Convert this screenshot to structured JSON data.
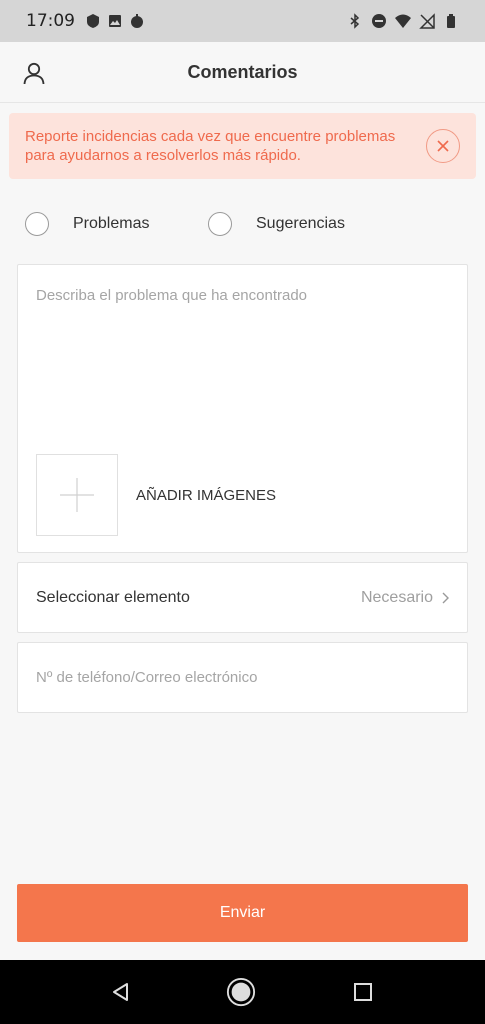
{
  "status_bar": {
    "time": "17:09",
    "left_icons": [
      "shield-icon",
      "image-icon",
      "bomb-icon"
    ],
    "right_icons": [
      "bluetooth-icon",
      "do-not-disturb-icon",
      "wifi-icon",
      "no-signal-icon",
      "battery-icon"
    ]
  },
  "header": {
    "title": "Comentarios",
    "user_icon": "user-icon"
  },
  "notice": {
    "text": "Reporte incidencias cada vez que encuentre problemas para ayudarnos a resolverlos más rápido.",
    "close_icon": "close-icon"
  },
  "feedback_type": {
    "options": [
      {
        "label": "Problemas",
        "selected": false
      },
      {
        "label": "Sugerencias",
        "selected": false
      }
    ]
  },
  "description": {
    "placeholder": "Describa el problema que ha encontrado",
    "add_images_label": "AÑADIR IMÁGENES",
    "add_icon": "plus-icon"
  },
  "select_item": {
    "label": "Seleccionar elemento",
    "value": "Necesario",
    "chevron_icon": "chevron-right-icon"
  },
  "contact": {
    "placeholder": "Nº de teléfono/Correo electrónico"
  },
  "submit": {
    "label": "Enviar"
  },
  "colors": {
    "accent": "#f4764c",
    "notice_bg": "#fde3dc",
    "notice_text": "#ef6a4d"
  }
}
